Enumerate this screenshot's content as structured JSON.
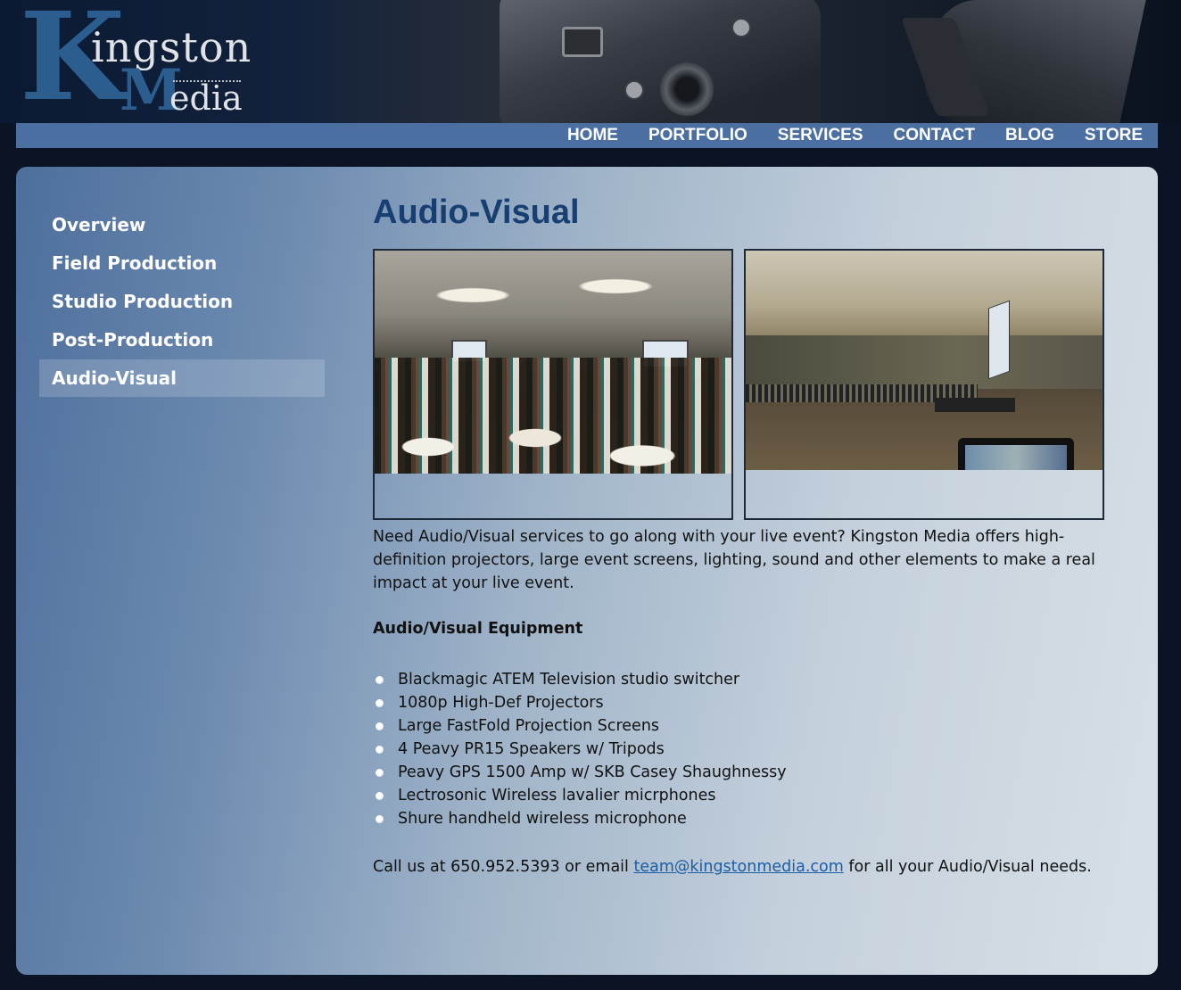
{
  "brand": {
    "logo_k": "K",
    "logo_ingston": "ingston",
    "logo_m": "M",
    "logo_edia": "edia"
  },
  "nav": {
    "items": [
      {
        "label": "HOME"
      },
      {
        "label": "PORTFOLIO"
      },
      {
        "label": "SERVICES"
      },
      {
        "label": "CONTACT"
      },
      {
        "label": "BLOG"
      },
      {
        "label": "STORE"
      }
    ]
  },
  "sidebar": {
    "active": "Audio-Visual",
    "items": [
      {
        "label": "Overview"
      },
      {
        "label": "Field Production"
      },
      {
        "label": "Studio Production"
      },
      {
        "label": "Post-Production"
      },
      {
        "label": "Audio-Visual"
      }
    ]
  },
  "main": {
    "title": "Audio-Visual",
    "intro": "Need Audio/Visual services to go along with your live event?  Kingston Media offers high-definition projectors, large event screens, lighting, sound and other elements to make a real impact at your live event.",
    "equipment_heading": "Audio/Visual Equipment",
    "equipment": [
      "Blackmagic ATEM Television studio switcher",
      "1080p High-Def Projectors",
      "Large FastFold Projection Screens",
      "4 Peavy PR15 Speakers w/ Tripods",
      "Peavy GPS 1500 Amp w/ SKB Casey Shaughnessy",
      "Lectrosonic Wireless lavalier micrphones",
      "Shure handheld wireless microphone"
    ],
    "contact": {
      "prefix": "Call us at 650.952.5393 or email ",
      "email": "team@kingstonmedia.com",
      "suffix": " for all your Audio/Visual needs."
    }
  },
  "colors": {
    "nav_bar": "#4a6fa0",
    "title": "#173f72",
    "link": "#1a5ea5",
    "logo_blue": "#2b5d8f"
  },
  "icons": {
    "bullet": "white-dot-bullet-icon"
  }
}
